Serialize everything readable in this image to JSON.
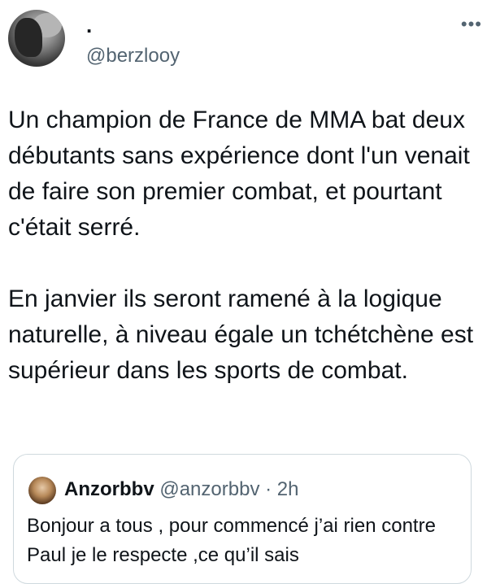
{
  "tweet": {
    "display_name": ".",
    "handle": "@berzlooy",
    "more_label": "•••",
    "text": "Un champion de France de MMA bat deux débutants sans expérience dont l'un venait de faire son premier combat, et pourtant c'était serré.\n\nEn janvier ils seront ramené à la logique naturelle, à niveau égale un tchétchène est supérieur dans les sports de combat."
  },
  "quote": {
    "name": "Anzorbbv",
    "handle": "@anzorbbv",
    "separator": "·",
    "time": "2h",
    "text": "Bonjour a tous , pour commencé j’ai rien contre Paul je le respecte ,ce qu’il sais"
  }
}
